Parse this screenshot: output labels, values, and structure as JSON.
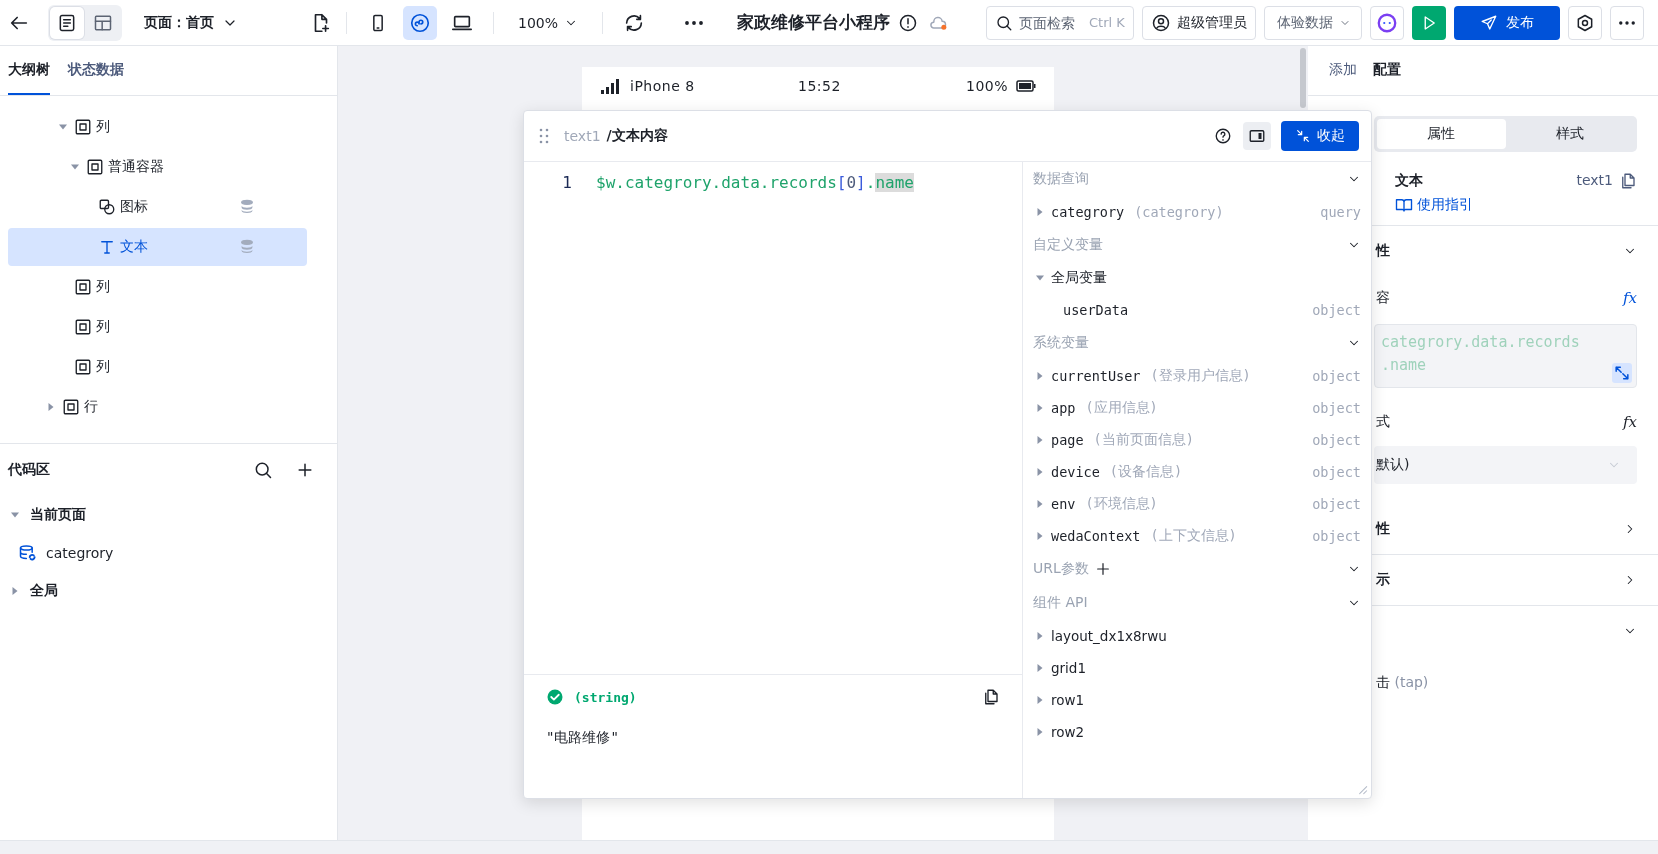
{
  "toolbar": {
    "view_modes": [
      {
        "kind": "outline",
        "selected": true
      },
      {
        "kind": "layout",
        "selected": false
      }
    ],
    "page_label": "页面：首页",
    "devices": [
      {
        "kind": "phone",
        "selected": false
      },
      {
        "kind": "miniprogram",
        "selected": true
      },
      {
        "kind": "desktop",
        "selected": false
      }
    ],
    "zoom": "100%",
    "title": "家政维修平台小程序",
    "search": {
      "placeholder": "页面检索",
      "shortcut": "Ctrl K"
    },
    "role": "超级管理员",
    "data_mode": "体验数据",
    "publish": "发布"
  },
  "left_panel": {
    "tabs": [
      {
        "label": "大纲树",
        "selected": true
      },
      {
        "label": "状态数据",
        "selected": false
      }
    ],
    "tree": [
      {
        "children": [
          {
            "label": "列",
            "kind": "container",
            "expanded": true,
            "selected": false,
            "children": [
              {
                "label": "普通容器",
                "kind": "container",
                "expanded": true,
                "selected": false,
                "children": [
                  {
                    "label": "图标",
                    "kind": "icon",
                    "bound": true,
                    "selected": false
                  },
                  {
                    "label": "文本",
                    "kind": "text",
                    "bound": true,
                    "selected": true
                  }
                ]
              }
            ]
          },
          {
            "label": "列",
            "kind": "container",
            "selected": false
          },
          {
            "label": "列",
            "kind": "container",
            "selected": false
          },
          {
            "label": "列",
            "kind": "container",
            "selected": false
          }
        ]
      },
      {
        "label": "行",
        "kind": "container",
        "expanded": false,
        "selected": false
      }
    ],
    "code_title": "代码区",
    "code_tree": [
      {
        "label": "当前页面",
        "expanded": true,
        "children": [
          {
            "label": "categrory",
            "kind": "query"
          }
        ]
      },
      {
        "label": "全局",
        "expanded": false
      }
    ]
  },
  "phone": {
    "device": "iPhone 8",
    "time": "15:52",
    "battery": "100%"
  },
  "editor": {
    "breadcrumb": "text1",
    "title": "/文本内容",
    "collapse": "收起",
    "lines": [
      {
        "number": "1",
        "tokens": [
          {
            "text": "$w.categrory.data.records",
            "kind": "ident",
            "selected": false
          },
          {
            "text": "[",
            "kind": "bracket",
            "selected": false
          },
          {
            "text": "0",
            "kind": "number",
            "selected": false
          },
          {
            "text": "]",
            "kind": "bracket",
            "selected": false
          },
          {
            "text": ".",
            "kind": "ident",
            "selected": false
          },
          {
            "text": "name",
            "kind": "ident",
            "selected": true
          }
        ]
      }
    ],
    "result": {
      "valid": true,
      "type": "(string)",
      "value": "\"电路维修\""
    },
    "sections": [
      {
        "title": "数据查询",
        "expanded": true,
        "items": [
          {
            "name": "categrory",
            "note": "(categrory)",
            "type": "query",
            "expanded": false
          }
        ]
      },
      {
        "title": "自定义变量",
        "expanded": true,
        "items": [
          {
            "name": "全局变量",
            "expanded": true,
            "children": [
              {
                "name": "userData",
                "type": "object"
              }
            ]
          }
        ]
      },
      {
        "title": "系统变量",
        "expanded": true,
        "items": [
          {
            "name": "currentUser",
            "note": "(登录用户信息)",
            "type": "object",
            "expanded": false
          },
          {
            "name": "app",
            "note": "(应用信息)",
            "type": "object",
            "expanded": false
          },
          {
            "name": "page",
            "note": "(当前页面信息)",
            "type": "object",
            "expanded": false
          },
          {
            "name": "device",
            "note": "(设备信息)",
            "type": "object",
            "expanded": false
          },
          {
            "name": "env",
            "note": "(环境信息)",
            "type": "object",
            "expanded": false
          },
          {
            "name": "wedaContext",
            "note": "(上下文信息)",
            "type": "object",
            "expanded": false
          }
        ]
      },
      {
        "title": "URL参数",
        "addable": true,
        "expanded": true
      },
      {
        "title": "组件 API",
        "expanded": true,
        "items": [
          {
            "name": "layout_dx1x8rwu",
            "expanded": false
          },
          {
            "name": "grid1",
            "expanded": false
          },
          {
            "name": "row1",
            "expanded": false
          },
          {
            "name": "row2",
            "expanded": false
          }
        ]
      }
    ]
  },
  "right_panel": {
    "tabs": [
      {
        "label": "添加",
        "selected": false
      },
      {
        "label": "配置",
        "selected": true
      }
    ],
    "segments": [
      {
        "label": "属性",
        "selected": true
      },
      {
        "label": "样式",
        "selected": false
      }
    ],
    "component": {
      "name": "文本",
      "id": "text1",
      "guide": "使用指引"
    },
    "rows": [
      {
        "kind": "section",
        "label": "性",
        "expanded": true
      },
      {
        "kind": "label",
        "label": "容",
        "formula": "𝑓x"
      },
      {
        "kind": "expression",
        "lines": [
          "categrory.data.records",
          ".name"
        ]
      },
      {
        "kind": "label",
        "label": "式",
        "formula": "𝑓x"
      },
      {
        "kind": "select",
        "value": "默认)"
      },
      {
        "kind": "section",
        "label": "性",
        "expanded": false
      },
      {
        "kind": "section",
        "label": "示",
        "expanded": false
      },
      {
        "kind": "section",
        "expanded": true
      },
      {
        "kind": "event",
        "label": "击",
        "note": "(tap)"
      }
    ]
  }
}
